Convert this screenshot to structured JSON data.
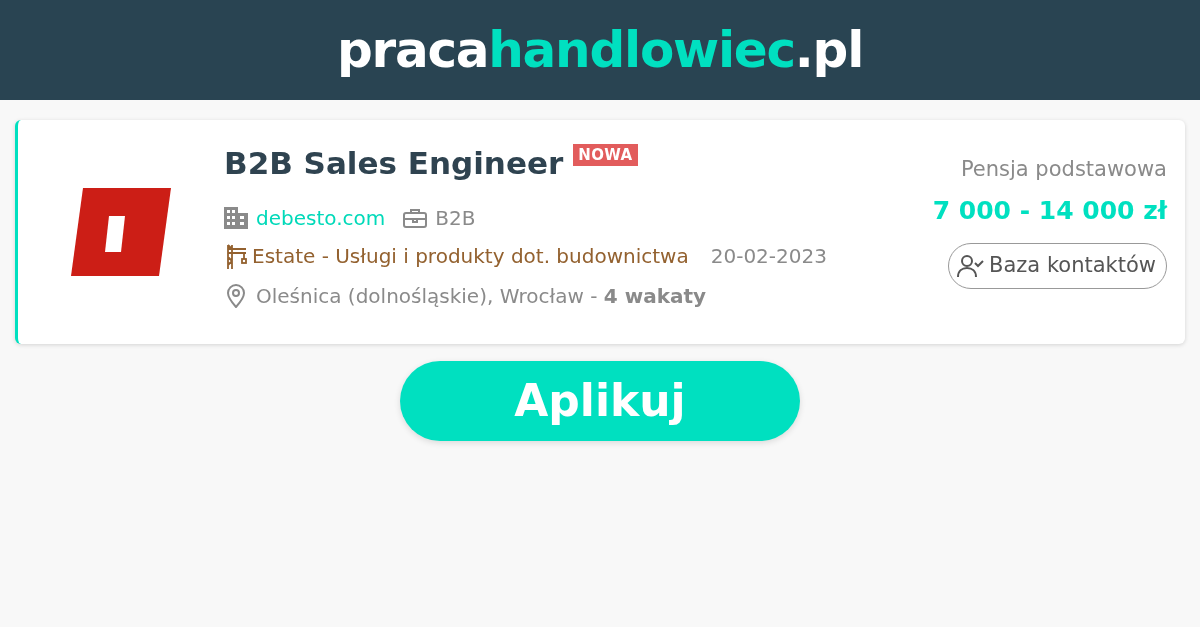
{
  "header": {
    "logo_parts": [
      {
        "text": "praca",
        "kind": "plain"
      },
      {
        "text": "handlowiec",
        "kind": "accent"
      },
      {
        "text": ".pl",
        "kind": "plain"
      }
    ]
  },
  "offer": {
    "title": "B2B Sales Engineer",
    "badge": "NOWA",
    "company": "debesto.com",
    "contract": "B2B",
    "industry": "Estate - Usługi i produkty dot. budownictwa",
    "date": "20-02-2023",
    "location": "Oleśnica (dolnośląskie), Wrocław - **4 wakaty**",
    "salary_label": "Pensja podstawowa",
    "salary": "7 000 - 14 000 zł",
    "contacts_button": "Baza kontaktów"
  },
  "apply_button": "Aplikuj"
}
